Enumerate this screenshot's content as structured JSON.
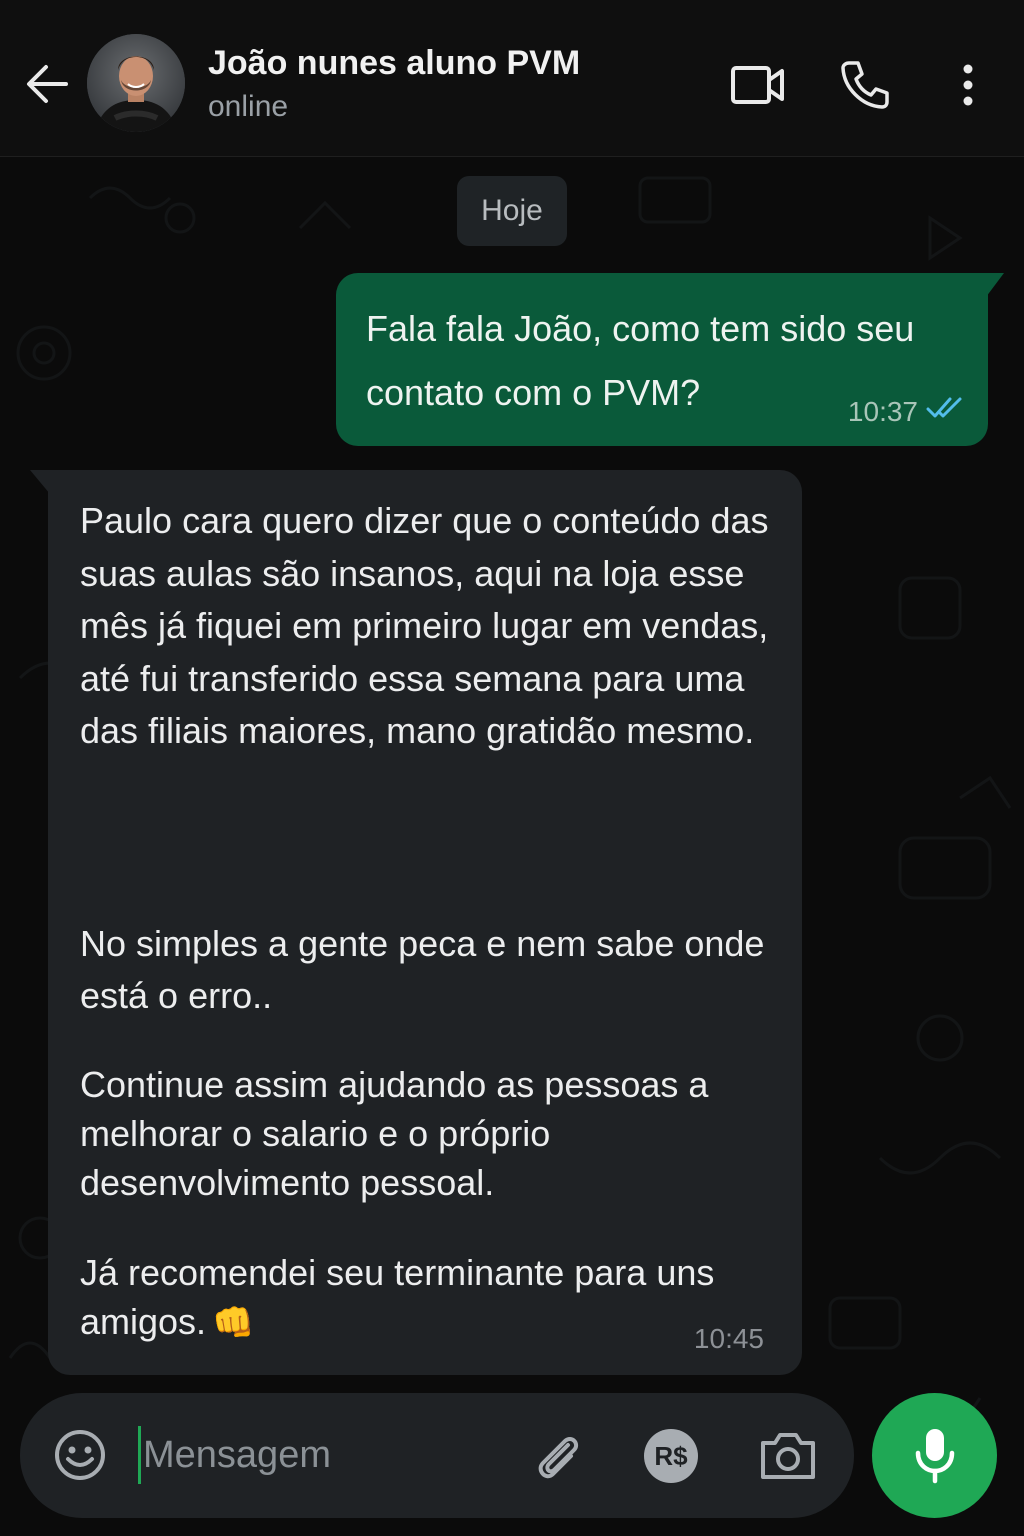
{
  "header": {
    "contact_name": "João nunes aluno PVM",
    "status": "online",
    "icons": [
      "back-arrow-icon",
      "avatar",
      "video-call-icon",
      "phone-call-icon",
      "more-vertical-icon"
    ]
  },
  "chat": {
    "date_label": "Hoje",
    "outgoing": {
      "text": "Fala fala João, como tem sido seu contato com o PVM?",
      "time": "10:37",
      "status_icon": "double-check-read-icon"
    },
    "incoming": {
      "paragraphs": [
        "Paulo cara quero dizer que o conteúdo das suas aulas são insanos, aqui na loja esse mês já fiquei em primeiro lugar em vendas, até fui transferido essa semana para uma das filiais maiores, mano gratidão mesmo.",
        "No simples a gente peca e nem sabe onde está o erro..",
        "Continue assim ajudando as pessoas a melhorar o salario e o próprio desenvolvimento pessoal.",
        "Já recomendei seu terminante para uns amigos."
      ],
      "emoji": "👊",
      "time": "10:45"
    }
  },
  "composer": {
    "placeholder": "Mensagem",
    "payment_label": "R$",
    "icons": [
      "emoji-icon",
      "attach-icon",
      "payment-icon",
      "camera-icon",
      "mic-icon"
    ]
  },
  "colors": {
    "background": "#0b0b0b",
    "outgoing_bubble": "#0a5a3a",
    "incoming_bubble": "#1f2225",
    "accent": "#1fa855",
    "read_check": "#53bdeb"
  }
}
